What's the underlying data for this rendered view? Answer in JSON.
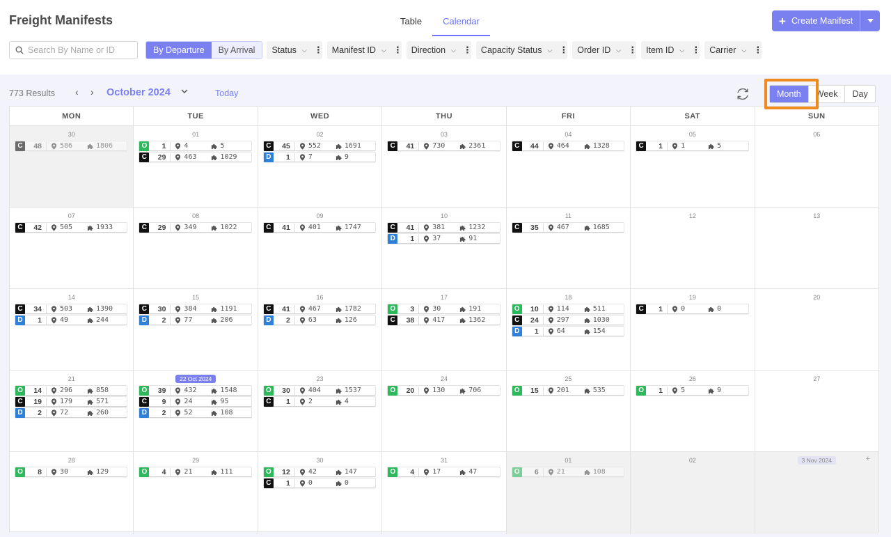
{
  "header": {
    "title": "Freight Manifests",
    "tabs": [
      {
        "label": "Table",
        "active": false
      },
      {
        "label": "Calendar",
        "active": true
      }
    ],
    "create_label": "Create Manifest"
  },
  "filters": {
    "search_placeholder": "Search By Name or ID",
    "mode": [
      {
        "label": "By Departure",
        "active": true
      },
      {
        "label": "By Arrival",
        "active": false
      }
    ],
    "pills": [
      "Status",
      "Manifest ID",
      "Direction",
      "Capacity Status",
      "Order ID",
      "Item ID",
      "Carrier"
    ]
  },
  "calendar": {
    "results": "773 Results",
    "month": "October 2024",
    "today_label": "Today",
    "ranges": [
      {
        "label": "Month",
        "active": true
      },
      {
        "label": "Week",
        "active": false
      },
      {
        "label": "Day",
        "active": false
      }
    ],
    "weekdays": [
      "MON",
      "TUE",
      "WED",
      "THU",
      "FRI",
      "SAT",
      "SUN"
    ],
    "weeks": [
      [
        {
          "label": "30",
          "muted": true,
          "entries": [
            [
              "C",
              "48",
              "586",
              "1806"
            ]
          ]
        },
        {
          "label": "01",
          "entries": [
            [
              "O",
              "1",
              "4",
              "5"
            ],
            [
              "C",
              "29",
              "463",
              "1029"
            ]
          ]
        },
        {
          "label": "02",
          "entries": [
            [
              "C",
              "45",
              "552",
              "1691"
            ],
            [
              "D",
              "1",
              "7",
              "9"
            ]
          ]
        },
        {
          "label": "03",
          "entries": [
            [
              "C",
              "41",
              "730",
              "2361"
            ]
          ]
        },
        {
          "label": "04",
          "entries": [
            [
              "C",
              "44",
              "464",
              "1328"
            ]
          ]
        },
        {
          "label": "05",
          "entries": [
            [
              "C",
              "1",
              "1",
              "5"
            ]
          ]
        },
        {
          "label": "06",
          "entries": []
        }
      ],
      [
        {
          "label": "07",
          "entries": [
            [
              "C",
              "42",
              "505",
              "1933"
            ]
          ]
        },
        {
          "label": "08",
          "entries": [
            [
              "C",
              "29",
              "349",
              "1022"
            ]
          ]
        },
        {
          "label": "09",
          "entries": [
            [
              "C",
              "41",
              "401",
              "1747"
            ]
          ]
        },
        {
          "label": "10",
          "entries": [
            [
              "C",
              "41",
              "381",
              "1232"
            ],
            [
              "D",
              "1",
              "37",
              "91"
            ]
          ]
        },
        {
          "label": "11",
          "entries": [
            [
              "C",
              "35",
              "467",
              "1685"
            ]
          ]
        },
        {
          "label": "12",
          "entries": []
        },
        {
          "label": "13",
          "entries": []
        }
      ],
      [
        {
          "label": "14",
          "entries": [
            [
              "C",
              "34",
              "503",
              "1390"
            ],
            [
              "D",
              "1",
              "49",
              "244"
            ]
          ]
        },
        {
          "label": "15",
          "entries": [
            [
              "C",
              "30",
              "384",
              "1191"
            ],
            [
              "D",
              "2",
              "77",
              "206"
            ]
          ]
        },
        {
          "label": "16",
          "entries": [
            [
              "C",
              "41",
              "467",
              "1782"
            ],
            [
              "D",
              "2",
              "63",
              "126"
            ]
          ]
        },
        {
          "label": "17",
          "entries": [
            [
              "O",
              "3",
              "30",
              "191"
            ],
            [
              "C",
              "38",
              "417",
              "1362"
            ]
          ]
        },
        {
          "label": "18",
          "entries": [
            [
              "O",
              "10",
              "114",
              "511"
            ],
            [
              "C",
              "24",
              "297",
              "1030"
            ],
            [
              "D",
              "1",
              "64",
              "154"
            ]
          ]
        },
        {
          "label": "19",
          "entries": [
            [
              "C",
              "1",
              "0",
              "0"
            ]
          ]
        },
        {
          "label": "20",
          "entries": []
        }
      ],
      [
        {
          "label": "21",
          "entries": [
            [
              "O",
              "14",
              "296",
              "858"
            ],
            [
              "C",
              "19",
              "179",
              "571"
            ],
            [
              "D",
              "2",
              "72",
              "260"
            ]
          ]
        },
        {
          "label": "22 Oct 2024",
          "today": true,
          "entries": [
            [
              "O",
              "39",
              "432",
              "1548"
            ],
            [
              "C",
              "9",
              "24",
              "95"
            ],
            [
              "D",
              "2",
              "52",
              "108"
            ]
          ]
        },
        {
          "label": "23",
          "entries": [
            [
              "O",
              "30",
              "404",
              "1537"
            ],
            [
              "C",
              "1",
              "2",
              "4"
            ]
          ]
        },
        {
          "label": "24",
          "entries": [
            [
              "O",
              "20",
              "130",
              "706"
            ]
          ]
        },
        {
          "label": "25",
          "entries": [
            [
              "O",
              "15",
              "201",
              "535"
            ]
          ]
        },
        {
          "label": "26",
          "entries": [
            [
              "O",
              "1",
              "5",
              "9"
            ]
          ]
        },
        {
          "label": "27",
          "entries": []
        }
      ],
      [
        {
          "label": "28",
          "entries": [
            [
              "O",
              "8",
              "30",
              "129"
            ]
          ]
        },
        {
          "label": "29",
          "entries": [
            [
              "O",
              "4",
              "21",
              "111"
            ]
          ]
        },
        {
          "label": "30",
          "entries": [
            [
              "O",
              "12",
              "42",
              "147"
            ],
            [
              "C",
              "1",
              "0",
              "0"
            ]
          ]
        },
        {
          "label": "31",
          "entries": [
            [
              "O",
              "4",
              "17",
              "47"
            ]
          ]
        },
        {
          "label": "01",
          "muted": true,
          "entries": [
            [
              "O",
              "6",
              "21",
              "108"
            ]
          ]
        },
        {
          "label": "02",
          "muted": true,
          "entries": []
        },
        {
          "label": "3 Nov 2024",
          "muted": true,
          "nov": true,
          "add": "+",
          "entries": []
        }
      ]
    ]
  }
}
